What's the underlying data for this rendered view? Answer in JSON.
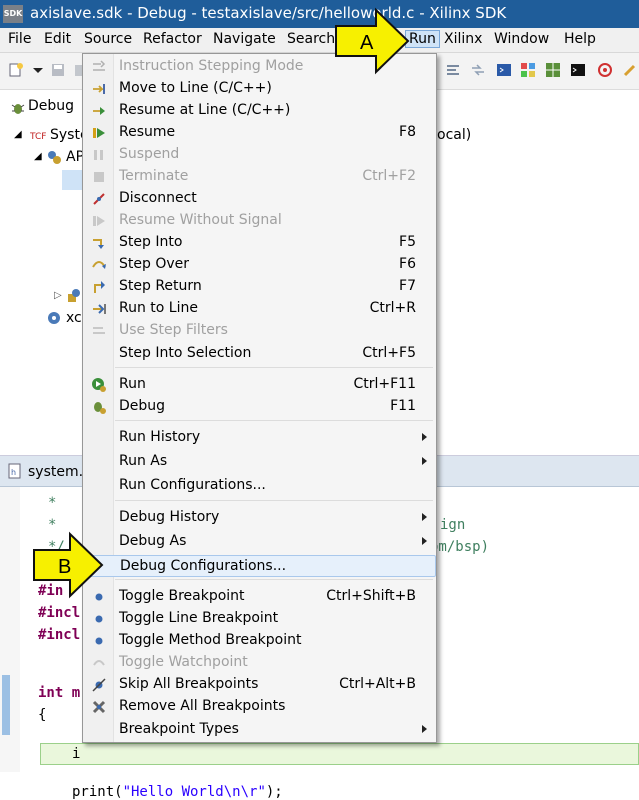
{
  "window": {
    "title": "axislave.sdk - Debug - testaxislave/src/helloworld.c - Xilinx SDK",
    "app_badge": "SDK"
  },
  "menubar": [
    "File",
    "Edit",
    "Source",
    "Refactor",
    "Navigate",
    "Search",
    "Run",
    "Xilinx",
    "Window",
    "Help"
  ],
  "debug_view": {
    "tab": "Debug",
    "tree": [
      "Syste",
      "AP",
      "xc"
    ],
    "suffix": "ocal)"
  },
  "editor": {
    "tab": "system.h",
    "lines": [
      "*",
      "*",
      "*/",
      "#in",
      "#incl",
      "#incl",
      "int m",
      "{",
      "i",
      "print(\"Hello World\\n\\r\");"
    ],
    "right_fragments": [
      "ign",
      "om/bsp)"
    ]
  },
  "run_menu": {
    "items": [
      {
        "label": "Instruction Stepping Mode",
        "shortcut": "",
        "disabled": true,
        "icon": "instruction-step-icon"
      },
      {
        "label": "Move to Line (C/C++)",
        "shortcut": "",
        "disabled": false,
        "icon": "move-to-line-icon"
      },
      {
        "label": "Resume at Line (C/C++)",
        "shortcut": "",
        "disabled": false,
        "icon": "resume-at-line-icon"
      },
      {
        "label": "Resume",
        "shortcut": "F8",
        "disabled": false,
        "icon": "resume-icon"
      },
      {
        "label": "Suspend",
        "shortcut": "",
        "disabled": true,
        "icon": "suspend-icon"
      },
      {
        "label": "Terminate",
        "shortcut": "Ctrl+F2",
        "disabled": true,
        "icon": "terminate-icon"
      },
      {
        "label": "Disconnect",
        "shortcut": "",
        "disabled": false,
        "icon": "disconnect-icon"
      },
      {
        "label": "Resume Without Signal",
        "shortcut": "",
        "disabled": true,
        "icon": "resume-without-signal-icon"
      },
      {
        "label": "Step Into",
        "shortcut": "F5",
        "disabled": false,
        "icon": "step-into-icon"
      },
      {
        "label": "Step Over",
        "shortcut": "F6",
        "disabled": false,
        "icon": "step-over-icon"
      },
      {
        "label": "Step Return",
        "shortcut": "F7",
        "disabled": false,
        "icon": "step-return-icon"
      },
      {
        "label": "Run to Line",
        "shortcut": "Ctrl+R",
        "disabled": false,
        "icon": "run-to-line-icon"
      },
      {
        "label": "Use Step Filters",
        "shortcut": "",
        "disabled": true,
        "icon": "step-filters-icon"
      },
      {
        "label": "Step Into Selection",
        "shortcut": "Ctrl+F5",
        "disabled": false,
        "icon": ""
      },
      {
        "label": "Run",
        "shortcut": "Ctrl+F11",
        "disabled": false,
        "icon": "run-icon"
      },
      {
        "label": "Debug",
        "shortcut": "F11",
        "disabled": false,
        "icon": "debug-icon"
      },
      {
        "label": "Run History",
        "shortcut": "",
        "disabled": false,
        "icon": "",
        "submenu": true
      },
      {
        "label": "Run As",
        "shortcut": "",
        "disabled": false,
        "icon": "",
        "submenu": true
      },
      {
        "label": "Run Configurations...",
        "shortcut": "",
        "disabled": false,
        "icon": ""
      },
      {
        "label": "Debug History",
        "shortcut": "",
        "disabled": false,
        "icon": "",
        "submenu": true
      },
      {
        "label": "Debug As",
        "shortcut": "",
        "disabled": false,
        "icon": "",
        "submenu": true
      },
      {
        "label": "Debug Configurations...",
        "shortcut": "",
        "disabled": false,
        "icon": "",
        "highlighted": true
      },
      {
        "label": "Toggle Breakpoint",
        "shortcut": "Ctrl+Shift+B",
        "disabled": false,
        "icon": "breakpoint-icon"
      },
      {
        "label": "Toggle Line Breakpoint",
        "shortcut": "",
        "disabled": false,
        "icon": "line-breakpoint-icon"
      },
      {
        "label": "Toggle Method Breakpoint",
        "shortcut": "",
        "disabled": false,
        "icon": "method-breakpoint-icon"
      },
      {
        "label": "Toggle Watchpoint",
        "shortcut": "",
        "disabled": true,
        "icon": "watchpoint-icon"
      },
      {
        "label": "Skip All Breakpoints",
        "shortcut": "Ctrl+Alt+B",
        "disabled": false,
        "icon": "skip-breakpoints-icon"
      },
      {
        "label": "Remove All Breakpoints",
        "shortcut": "",
        "disabled": false,
        "icon": "remove-breakpoints-icon"
      },
      {
        "label": "Breakpoint Types",
        "shortcut": "",
        "disabled": false,
        "icon": "",
        "submenu": true
      }
    ]
  },
  "callouts": {
    "a": "A",
    "b": "B"
  },
  "colors": {
    "titlebar": "#1f5d9a",
    "callout": "#f7f000",
    "highlight": "#e6f0fb"
  }
}
